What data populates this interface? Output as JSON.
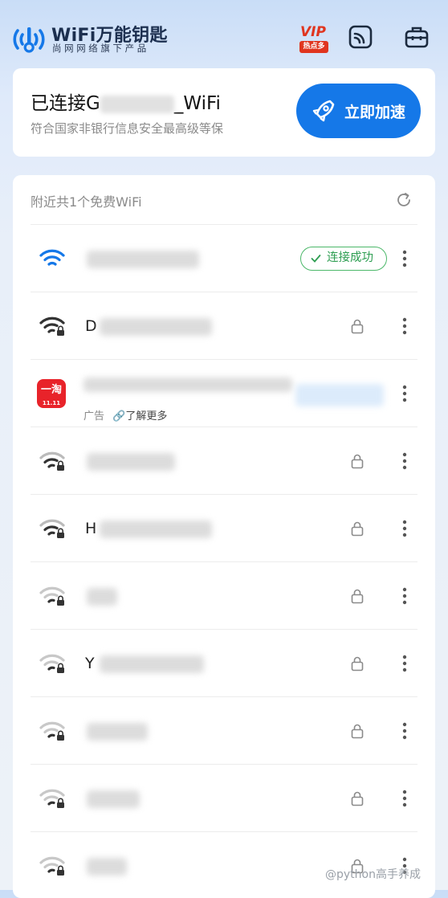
{
  "header": {
    "app_name": "WiFi万能钥匙",
    "tagline": "尚网网络旗下产品",
    "vip_label": "VIP",
    "vip_tag": "热点多",
    "icons": [
      "wifi-logo-icon",
      "scan-icon",
      "toolbox-icon"
    ]
  },
  "connection": {
    "prefix": "已连接G",
    "suffix": "_WiFi",
    "subtitle": "符合国家非银行信息安全最高级等保",
    "speed_button": "立即加速"
  },
  "list": {
    "header": "附近共1个免费WiFi",
    "rows": [
      {
        "ssid_visible": "",
        "status": "连接成功",
        "signal": "strong",
        "secured": false
      },
      {
        "ssid_visible": "D",
        "signal": "strong",
        "secured": true
      },
      {
        "ssid_visible": "",
        "is_ad": true,
        "ad_label": "广告",
        "ad_more": "了解更多",
        "ad_logo": "一淘",
        "ad_logo_sub": "11.11"
      },
      {
        "ssid_visible": "",
        "signal": "medium",
        "secured": true
      },
      {
        "ssid_visible": "H",
        "signal": "medium",
        "secured": true
      },
      {
        "ssid_visible": "",
        "signal": "weak",
        "secured": true
      },
      {
        "ssid_visible": "Y",
        "signal": "weak",
        "secured": true
      },
      {
        "ssid_visible": "",
        "signal": "weak",
        "secured": true
      },
      {
        "ssid_visible": "",
        "signal": "weak",
        "secured": true
      },
      {
        "ssid_visible": "",
        "signal": "weak",
        "secured": true
      }
    ]
  },
  "watermark": "@python高手养成",
  "colors": {
    "accent": "#1578e8",
    "success": "#2e9e52",
    "ad_red": "#e8232a"
  }
}
